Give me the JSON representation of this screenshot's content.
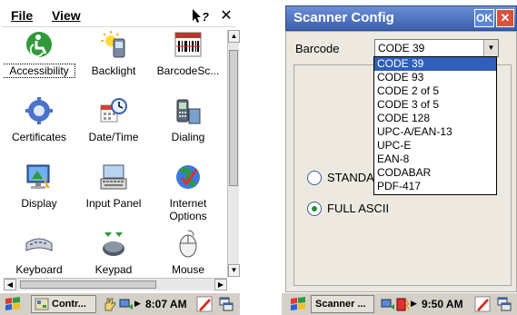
{
  "left_screen": {
    "menu": {
      "file": "File",
      "view": "View"
    },
    "help_label": "?",
    "close_label": "✕",
    "items": [
      {
        "label": "Accessibility",
        "icon": "accessibility-icon"
      },
      {
        "label": "Backlight",
        "icon": "backlight-icon"
      },
      {
        "label": "BarcodeSc...",
        "icon": "barcode-scanner-icon"
      },
      {
        "label": "Certificates",
        "icon": "certificates-icon"
      },
      {
        "label": "Date/Time",
        "icon": "date-time-icon"
      },
      {
        "label": "Dialing",
        "icon": "dialing-icon"
      },
      {
        "label": "Display",
        "icon": "display-icon"
      },
      {
        "label": "Input Panel",
        "icon": "input-panel-icon"
      },
      {
        "label": "Internet Options",
        "icon": "internet-options-icon"
      },
      {
        "label": "Keyboard",
        "icon": "keyboard-icon"
      },
      {
        "label": "Keypad",
        "icon": "keypad-icon"
      },
      {
        "label": "Mouse",
        "icon": "mouse-icon"
      }
    ],
    "taskbar": {
      "task_label": "Contr...",
      "time": "8:07 AM"
    }
  },
  "right_screen": {
    "title": "Scanner Config",
    "ok_label": "OK",
    "close_label": "✕",
    "barcode_label": "Barcode",
    "barcode_value": "CODE 39",
    "radio_standard": "STANDARD",
    "radio_full": "FULL ASCII",
    "options": [
      "CODE 39",
      "CODE 93",
      "CODE 2 of 5",
      "CODE 3 of 5",
      "CODE 128",
      "UPC-A/EAN-13",
      "UPC-E",
      "EAN-8",
      "CODABAR",
      "PDF-417"
    ],
    "selected_option": "CODE 39",
    "taskbar": {
      "task_label": "Scanner ...",
      "time": "9:50 AM"
    }
  },
  "colors": {
    "title_bar": "#3a5fae",
    "selection": "#2f5fb8",
    "close_button": "#d8523a",
    "dialog_bg": "#ede9e0",
    "taskbar": "#d4d0c8"
  }
}
